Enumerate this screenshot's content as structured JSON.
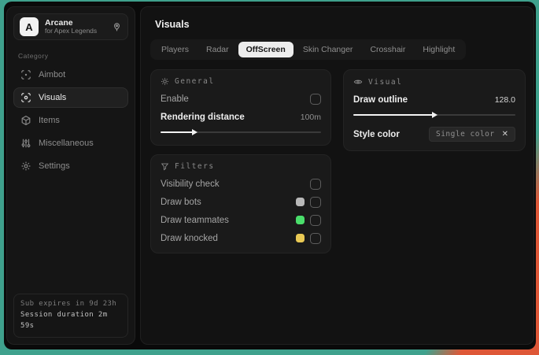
{
  "colors": {
    "backdrop_teal": "#3fa18d",
    "backdrop_orange": "#de5737",
    "window_bg": "#0a0a0a",
    "panel_bg": "#1a1a1a",
    "active_tab_bg": "#ededed"
  },
  "icons": {
    "close": "✕"
  },
  "sidebar": {
    "logo_letter": "A",
    "app_name": "Arcane",
    "app_subtitle": "for Apex Legends",
    "category_label": "Category",
    "items": [
      {
        "label": "Aimbot",
        "icon": "aimbot-icon",
        "selected": false
      },
      {
        "label": "Visuals",
        "icon": "visuals-icon",
        "selected": true
      },
      {
        "label": "Items",
        "icon": "items-icon",
        "selected": false
      },
      {
        "label": "Miscellaneous",
        "icon": "sliders-icon",
        "selected": false
      },
      {
        "label": "Settings",
        "icon": "gear-icon",
        "selected": false
      }
    ],
    "footer": {
      "line1": "Sub expires in 9d 23h",
      "line2": "Session duration 2m 59s"
    }
  },
  "main": {
    "title": "Visuals",
    "tabs": [
      {
        "label": "Players",
        "selected": false
      },
      {
        "label": "Radar",
        "selected": false
      },
      {
        "label": "OffScreen",
        "selected": true
      },
      {
        "label": "Skin Changer",
        "selected": false
      },
      {
        "label": "Crosshair",
        "selected": false
      },
      {
        "label": "Highlight",
        "selected": false
      }
    ],
    "panels": {
      "general": {
        "title": "General",
        "enable_label": "Enable",
        "enable_checked": false,
        "rendering_distance_label": "Rendering distance",
        "rendering_distance_value": "100m",
        "slider_fill": "20%"
      },
      "visual": {
        "title": "Visual",
        "draw_outline_label": "Draw outline",
        "draw_outline_value": "128.0",
        "slider_fill": "49%",
        "style_color_label": "Style color",
        "style_color_value": "Single color"
      },
      "filters": {
        "title": "Filters",
        "rows": [
          {
            "label": "Visibility check",
            "swatch": null,
            "checked": false
          },
          {
            "label": "Draw bots",
            "swatch": "#b8b8b8",
            "checked": false
          },
          {
            "label": "Draw teammates",
            "swatch": "#4ade6b",
            "checked": false
          },
          {
            "label": "Draw knocked",
            "swatch": "#e9c954",
            "checked": false
          }
        ]
      }
    }
  }
}
